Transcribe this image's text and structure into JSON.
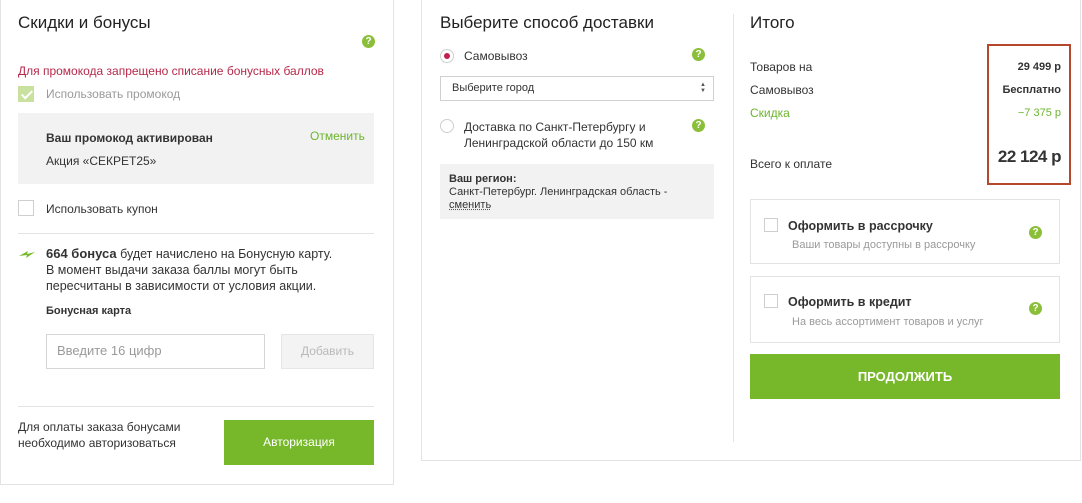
{
  "discounts": {
    "title": "Скидки и бонусы",
    "promo_error": "Для промокода запрещено списание бонусных баллов",
    "use_promo_label": "Использовать промокод",
    "promo_activated": "Ваш промокод активирован",
    "promo_cancel": "Отменить",
    "promo_action": "Акция «СЕКРЕТ25»",
    "use_coupon_label": "Использовать купон",
    "bonus_amount": "664 бонуса",
    "bonus_line1_rest": " будет начислено на Бонусную карту.",
    "bonus_line2": "В момент выдачи заказа баллы могут быть",
    "bonus_line3": "пересчитаны в зависимости от условия акции.",
    "bonus_card_label": "Бонусная карта",
    "card_placeholder": "Введите 16 цифр",
    "add_button": "Добавить",
    "auth_note_line1": "Для оплаты заказа бонусами",
    "auth_note_line2": "необходимо авторизоваться",
    "auth_button": "Авторизация"
  },
  "delivery": {
    "title": "Выберите способ доставки",
    "pickup_label": "Самовывоз",
    "city_select": "Выберите город",
    "courier_line1": "Доставка по Санкт-Петербургу и",
    "courier_line2": "Ленинградской области до 150 км",
    "region_label": "Ваш регион:",
    "region_value": "Санкт-Петербург. Ленинградская область -",
    "region_change": "сменить"
  },
  "summary": {
    "title": "Итого",
    "goods_label": "Товаров на",
    "goods_value": "29 499 р",
    "pickup_label": "Самовывоз",
    "pickup_value": "Бесплатно",
    "discount_label": "Скидка",
    "discount_value": "−7 375 р",
    "total_label": "Всего к оплате",
    "total_value": "22 124 р",
    "installment_title": "Оформить в рассрочку",
    "installment_sub": "Ваши товары доступны в рассрочку",
    "credit_title": "Оформить в кредит",
    "credit_sub": "На весь ассортимент товаров и услуг",
    "continue_button": "ПРОДОЛЖИТЬ"
  },
  "icons": {
    "help": "?",
    "bolt": "bolt-icon",
    "select_arrows": "▲▼"
  },
  "colors": {
    "accent_green": "#77b82a",
    "error_red": "#b5294a",
    "highlight_border": "#b5482c"
  }
}
